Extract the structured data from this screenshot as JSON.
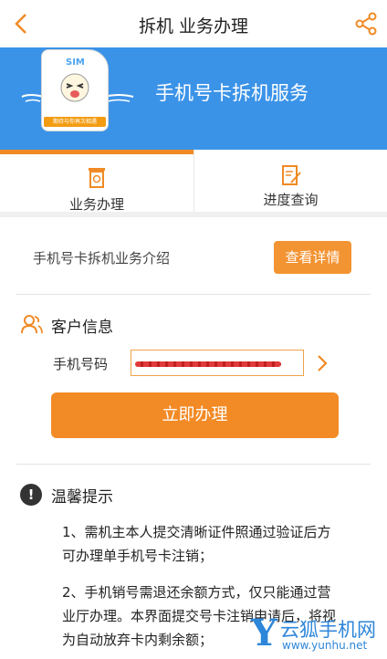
{
  "header": {
    "title": "拆机 业务办理",
    "back_icon": "back-chevron-icon",
    "share_icon": "share-icon"
  },
  "banner": {
    "title": "手机号卡拆机服务",
    "sim_label": "SIM",
    "sim_tag": "期待与你再次相遇",
    "background": "#3b93e8"
  },
  "tabs": [
    {
      "label": "业务办理",
      "icon": "trash-bin-icon",
      "active": true
    },
    {
      "label": "进度查询",
      "icon": "edit-document-icon",
      "active": false
    }
  ],
  "intro": {
    "label": "手机号卡拆机业务介绍",
    "detail_button": "查看详情"
  },
  "customer": {
    "section_title": "客户信息",
    "phone_label": "手机号码",
    "submit_button": "立即办理"
  },
  "tips": {
    "title": "温馨提示",
    "items": [
      "1、需机主本人提交清晰证件照通过验证后方可办理单手机号卡注销；",
      "2、手机销号需退还余额方式，仅只能通过营业厅办理。本界面提交号卡注销申请后，将视为自动放弃卡内剩余额；"
    ]
  },
  "watermark": {
    "logo": "Y",
    "text": "云狐手机网",
    "url": "www.yunhu.net"
  },
  "colors": {
    "accent": "#f28a26",
    "brand_blue": "#3b93e8"
  }
}
